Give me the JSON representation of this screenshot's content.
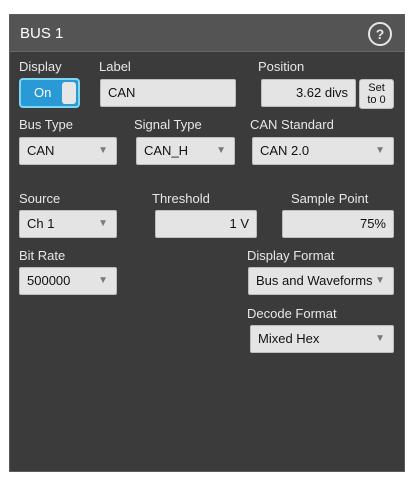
{
  "window": {
    "title": "BUS 1",
    "help_icon": "?"
  },
  "display": {
    "label": "Display",
    "toggle_text": "On",
    "state": "on"
  },
  "label_field": {
    "label": "Label",
    "value": "CAN"
  },
  "position": {
    "label": "Position",
    "value": "3.62 divs",
    "set_button_line1": "Set",
    "set_button_line2": "to 0"
  },
  "bus_type": {
    "label": "Bus Type",
    "value": "CAN"
  },
  "signal_type": {
    "label": "Signal Type",
    "value": "CAN_H"
  },
  "can_standard": {
    "label": "CAN Standard",
    "value": "CAN 2.0"
  },
  "source": {
    "label": "Source",
    "value": "Ch 1"
  },
  "threshold": {
    "label": "Threshold",
    "value": "1 V"
  },
  "sample_point": {
    "label": "Sample Point",
    "value": "75%"
  },
  "bit_rate": {
    "label": "Bit Rate",
    "value": "500000"
  },
  "display_format": {
    "label": "Display Format",
    "value": "Bus and Waveforms"
  },
  "decode_format": {
    "label": "Decode Format",
    "value": "Mixed Hex"
  },
  "colors": {
    "panel_bg": "#3b3b3b",
    "titlebar_bg": "#545454",
    "accent_toggle": "#2a9ad6"
  }
}
